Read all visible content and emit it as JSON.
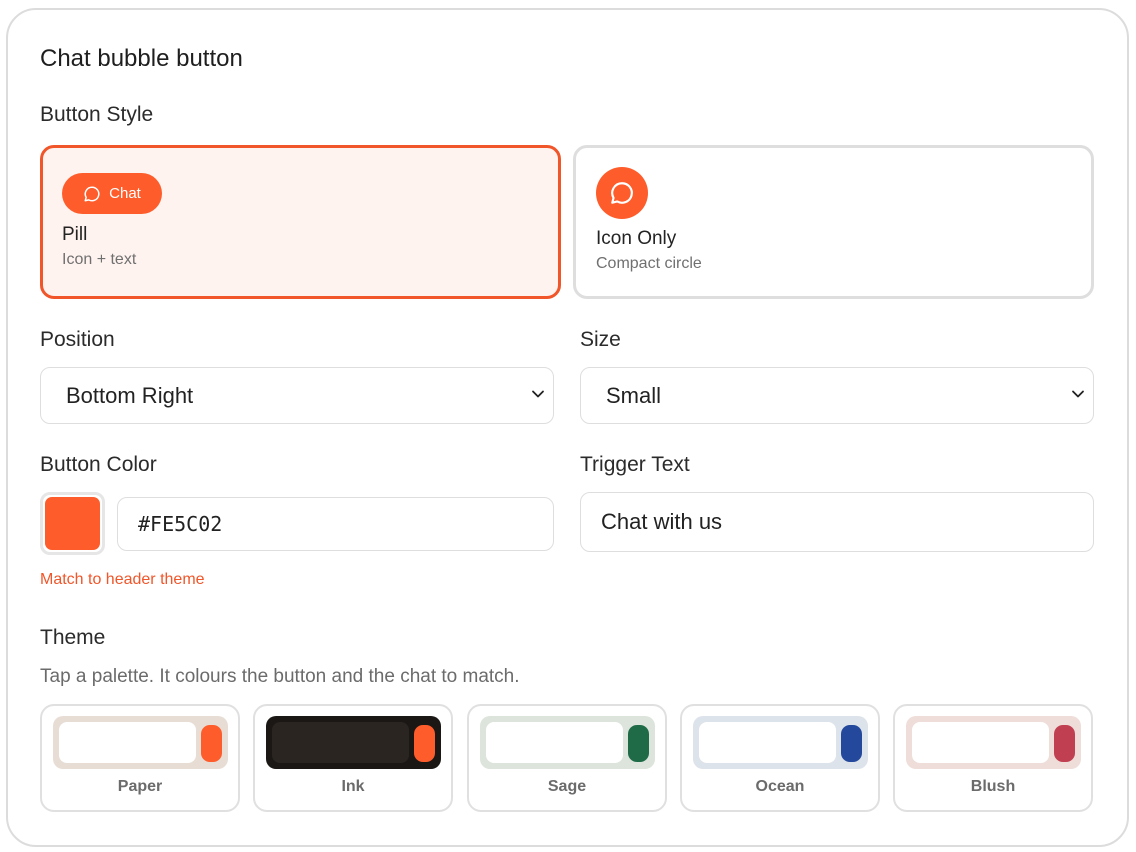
{
  "title": "Chat bubble button",
  "button_style": {
    "label": "Button Style",
    "options": [
      {
        "name": "Pill",
        "description": "Icon + text",
        "preview_text": "Chat",
        "selected": true
      },
      {
        "name": "Icon Only",
        "description": "Compact circle",
        "selected": false
      }
    ]
  },
  "position": {
    "label": "Position",
    "value": "Bottom Right"
  },
  "size": {
    "label": "Size",
    "value": "Small"
  },
  "button_color": {
    "label": "Button Color",
    "value": "#FE5C02",
    "swatch": "#fe5c2a",
    "match_link": "Match to header theme"
  },
  "trigger_text": {
    "label": "Trigger Text",
    "value": "Chat with us"
  },
  "theme": {
    "label": "Theme",
    "hint": "Tap a palette. It colours the button and the chat to match.",
    "palettes": [
      {
        "name": "Paper",
        "frame": "#e8ddd5",
        "bar": "#ffffff",
        "accent": "#fe5c2a"
      },
      {
        "name": "Ink",
        "frame": "#1a1715",
        "bar": "#2a2521",
        "accent": "#fe5c2a"
      },
      {
        "name": "Sage",
        "frame": "#dce4db",
        "bar": "#ffffff",
        "accent": "#1f6a47"
      },
      {
        "name": "Ocean",
        "frame": "#dde3ea",
        "bar": "#ffffff",
        "accent": "#23489c"
      },
      {
        "name": "Blush",
        "frame": "#eeddd8",
        "bar": "#ffffff",
        "accent": "#c04052"
      }
    ]
  },
  "accent_color": "#f0562a"
}
